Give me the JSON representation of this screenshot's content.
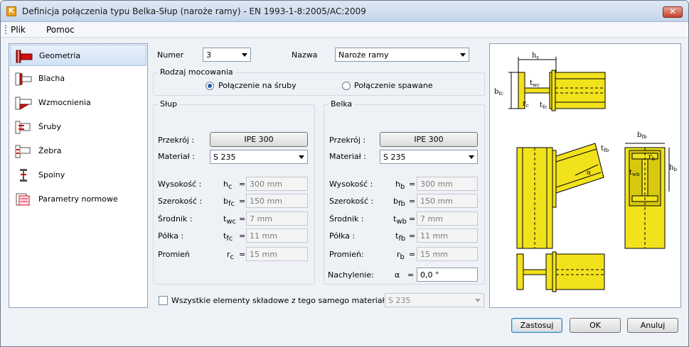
{
  "window": {
    "title": "Definicja połączenia typu Belka-Słup (naroże ramy) - EN 1993-1-8:2005/AC:2009",
    "app_icon": "K",
    "close_glyph": "✕"
  },
  "menu": {
    "file": "Plik",
    "help": "Pomoc"
  },
  "nav": {
    "items": [
      {
        "label": "Geometria",
        "icon": "geometry-icon",
        "selected": true
      },
      {
        "label": "Blacha",
        "icon": "plate-icon"
      },
      {
        "label": "Wzmocnienia",
        "icon": "stiffener-icon"
      },
      {
        "label": "Śruby",
        "icon": "bolt-icon"
      },
      {
        "label": "Żebra",
        "icon": "rib-icon"
      },
      {
        "label": "Spoiny",
        "icon": "weld-icon"
      },
      {
        "label": "Parametry normowe",
        "icon": "code-parameters-icon"
      }
    ]
  },
  "form": {
    "number_label": "Numer",
    "number_value": "3",
    "name_label": "Nazwa",
    "name_value": "Naroże ramy",
    "mount_group": "Rodzaj mocowania",
    "radio_bolted": "Połączenie na śruby",
    "radio_welded": "Połączenie spawane",
    "column": {
      "title": "Słup",
      "section_label": "Przekrój :",
      "section_value": "IPE 300",
      "material_label": "Materiał :",
      "material_value": "S 235",
      "rows": [
        {
          "label": "Wysokość :",
          "sym": "h",
          "sub": "c",
          "value": "300 mm"
        },
        {
          "label": "Szerokość :",
          "sym": "b",
          "sub": "fc",
          "value": "150 mm"
        },
        {
          "label": "Środnik :",
          "sym": "t",
          "sub": "wc",
          "value": "7 mm"
        },
        {
          "label": "Półka :",
          "sym": "t",
          "sub": "fc",
          "value": "11 mm"
        },
        {
          "label": "Promień",
          "sym": "r",
          "sub": "c",
          "value": "15 mm"
        }
      ]
    },
    "beam": {
      "title": "Belka",
      "section_label": "Przekrój :",
      "section_value": "IPE 300",
      "material_label": "Materiał :",
      "material_value": "S 235",
      "rows": [
        {
          "label": "Wysokość :",
          "sym": "h",
          "sub": "b",
          "value": "300 mm"
        },
        {
          "label": "Szerokość :",
          "sym": "b",
          "sub": "fb",
          "value": "150 mm"
        },
        {
          "label": "Środnik :",
          "sym": "t",
          "sub": "wb",
          "value": "7 mm"
        },
        {
          "label": "Półka :",
          "sym": "t",
          "sub": "fb",
          "value": "11 mm"
        },
        {
          "label": "Promień:",
          "sym": "r",
          "sub": "b",
          "value": "15 mm"
        }
      ],
      "slope_label": "Nachylenie:",
      "slope_sym": "α",
      "slope_value": "0,0 °"
    },
    "eq": "=",
    "same_material_label": "Wszystkie elementy składowe z tego samego materiału :",
    "same_material_value": "S 235"
  },
  "buttons": {
    "apply": "Zastosuj",
    "ok": "OK",
    "cancel": "Anuluj"
  },
  "drawing": {
    "labels": {
      "hc": "h",
      "hc_sub": "c",
      "bfc": "b",
      "bfc_sub": "fc",
      "twc": "t",
      "twc_sub": "wc",
      "rc": "r",
      "rc_sub": "c",
      "tfc": "t",
      "tfc_sub": "fc",
      "bfb": "b",
      "bfb_sub": "fb",
      "tfb": "t",
      "tfb_sub": "fb",
      "twb": "t",
      "twb_sub": "wb",
      "rb": "r",
      "rb_sub": "b",
      "hb": "h",
      "hb_sub": "b",
      "alpha": "α"
    },
    "colors": {
      "steel": "#f2e21c",
      "outline": "#000000",
      "accent": "#c00000"
    }
  }
}
